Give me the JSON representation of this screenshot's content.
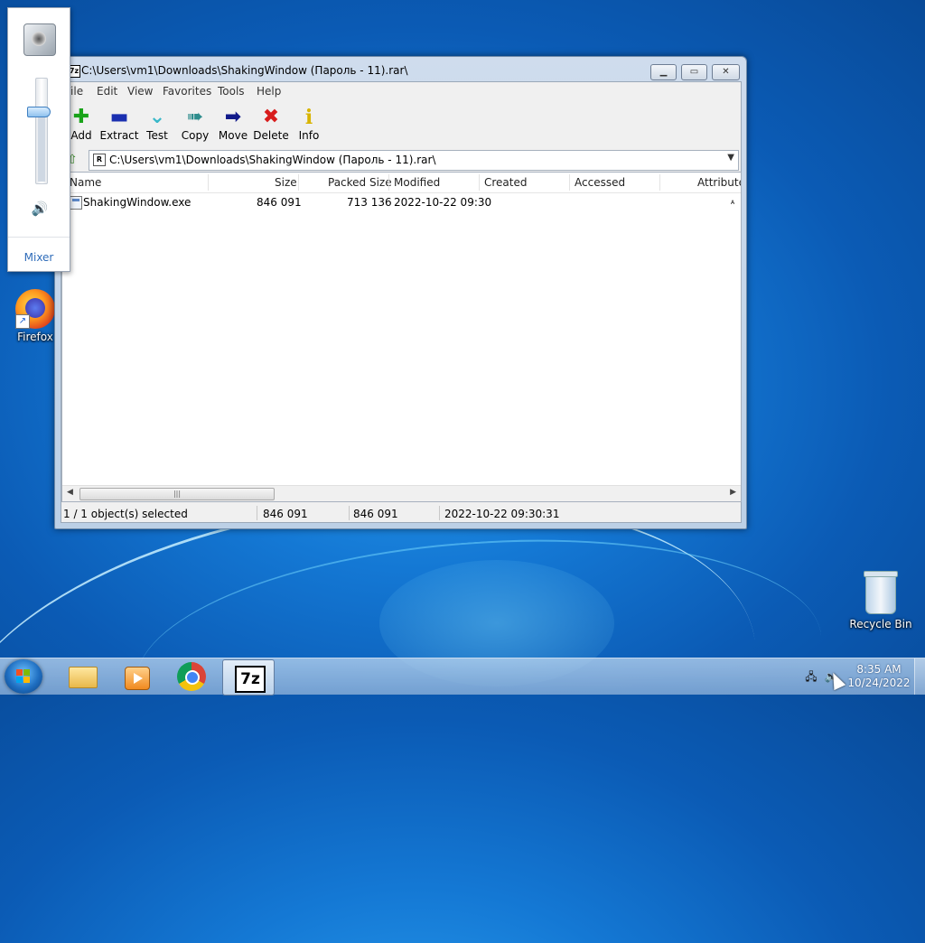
{
  "desktop": {
    "icons": [
      {
        "label": "Firefox"
      },
      {
        "label": "Recycle Bin"
      }
    ]
  },
  "volume_flyout": {
    "mixer_label": "Mixer",
    "level_percent": 68
  },
  "window": {
    "title": "C:\\Users\\vm1\\Downloads\\ShakingWindow (Пароль - 11).rar\\",
    "icon_text": "7z",
    "menu": [
      "File",
      "Edit",
      "View",
      "Favorites",
      "Tools",
      "Help"
    ],
    "toolbar": [
      {
        "label": "Add",
        "icon": "plus-icon",
        "color": "#1aa31a"
      },
      {
        "label": "Extract",
        "icon": "minus-icon",
        "color": "#1a2fb0"
      },
      {
        "label": "Test",
        "icon": "check-chevron-icon",
        "color": "#39b8c9"
      },
      {
        "label": "Copy",
        "icon": "double-arrow-icon",
        "color": "#2e8d8d"
      },
      {
        "label": "Move",
        "icon": "arrow-right-icon",
        "color": "#111a8a"
      },
      {
        "label": "Delete",
        "icon": "x-icon",
        "color": "#d81c1c"
      },
      {
        "label": "Info",
        "icon": "info-icon",
        "color": "#d8b400"
      }
    ],
    "address": "C:\\Users\\vm1\\Downloads\\ShakingWindow (Пароль - 11).rar\\",
    "columns": [
      "Name",
      "Size",
      "Packed Size",
      "Modified",
      "Created",
      "Accessed",
      "Attribute"
    ],
    "rows": [
      {
        "name": "ShakingWindow.exe",
        "size": "846 091",
        "packed": "713 136",
        "modified": "2022-10-22 09:30",
        "created": "",
        "accessed": "",
        "attr": "A"
      }
    ],
    "status": {
      "selection": "1 / 1 object(s) selected",
      "size": "846 091",
      "packed": "846 091",
      "modified": "2022-10-22 09:30:31"
    }
  },
  "taskbar": {
    "apps": [
      {
        "name": "file-explorer"
      },
      {
        "name": "media-player"
      },
      {
        "name": "chrome"
      },
      {
        "name": "7-zip",
        "label": "7z",
        "active": true
      }
    ],
    "clock": {
      "time": "8:35 AM",
      "date": "10/24/2022"
    }
  }
}
